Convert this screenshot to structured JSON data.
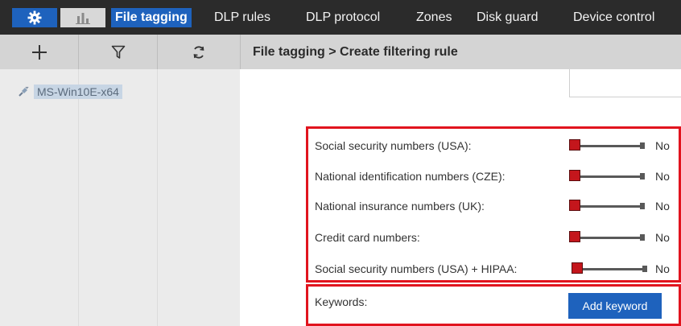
{
  "topnav": {
    "icons": {
      "settings": "gear-icon",
      "stats": "bar-chart-icon"
    },
    "tabs": [
      "File tagging",
      "DLP rules",
      "DLP protocol",
      "Zones",
      "Disk guard",
      "Device control"
    ],
    "active_tab": "File tagging"
  },
  "toolbar": {
    "icons": [
      "plus-icon",
      "filter-icon",
      "refresh-icon"
    ]
  },
  "breadcrumb": "File tagging > Create filtering rule",
  "sidebar": {
    "items": [
      {
        "label": "MS-Win10E-x64",
        "icon": "disconnected-plug-icon"
      }
    ]
  },
  "rules": [
    {
      "label": "Social security numbers (USA):",
      "value": "No"
    },
    {
      "label": "National identification numbers (CZE):",
      "value": "No"
    },
    {
      "label": "National insurance numbers (UK):",
      "value": "No"
    },
    {
      "label": "Credit card numbers:",
      "value": "No"
    },
    {
      "label": "Social security numbers (USA) + HIPAA:",
      "value": "No"
    }
  ],
  "keywords": {
    "label": "Keywords:",
    "button": "Add keyword"
  },
  "colors": {
    "accent": "#1e62bd",
    "highlight": "#e1141e",
    "slider_thumb": "#c4161c",
    "topbar": "#2b2b2b"
  }
}
